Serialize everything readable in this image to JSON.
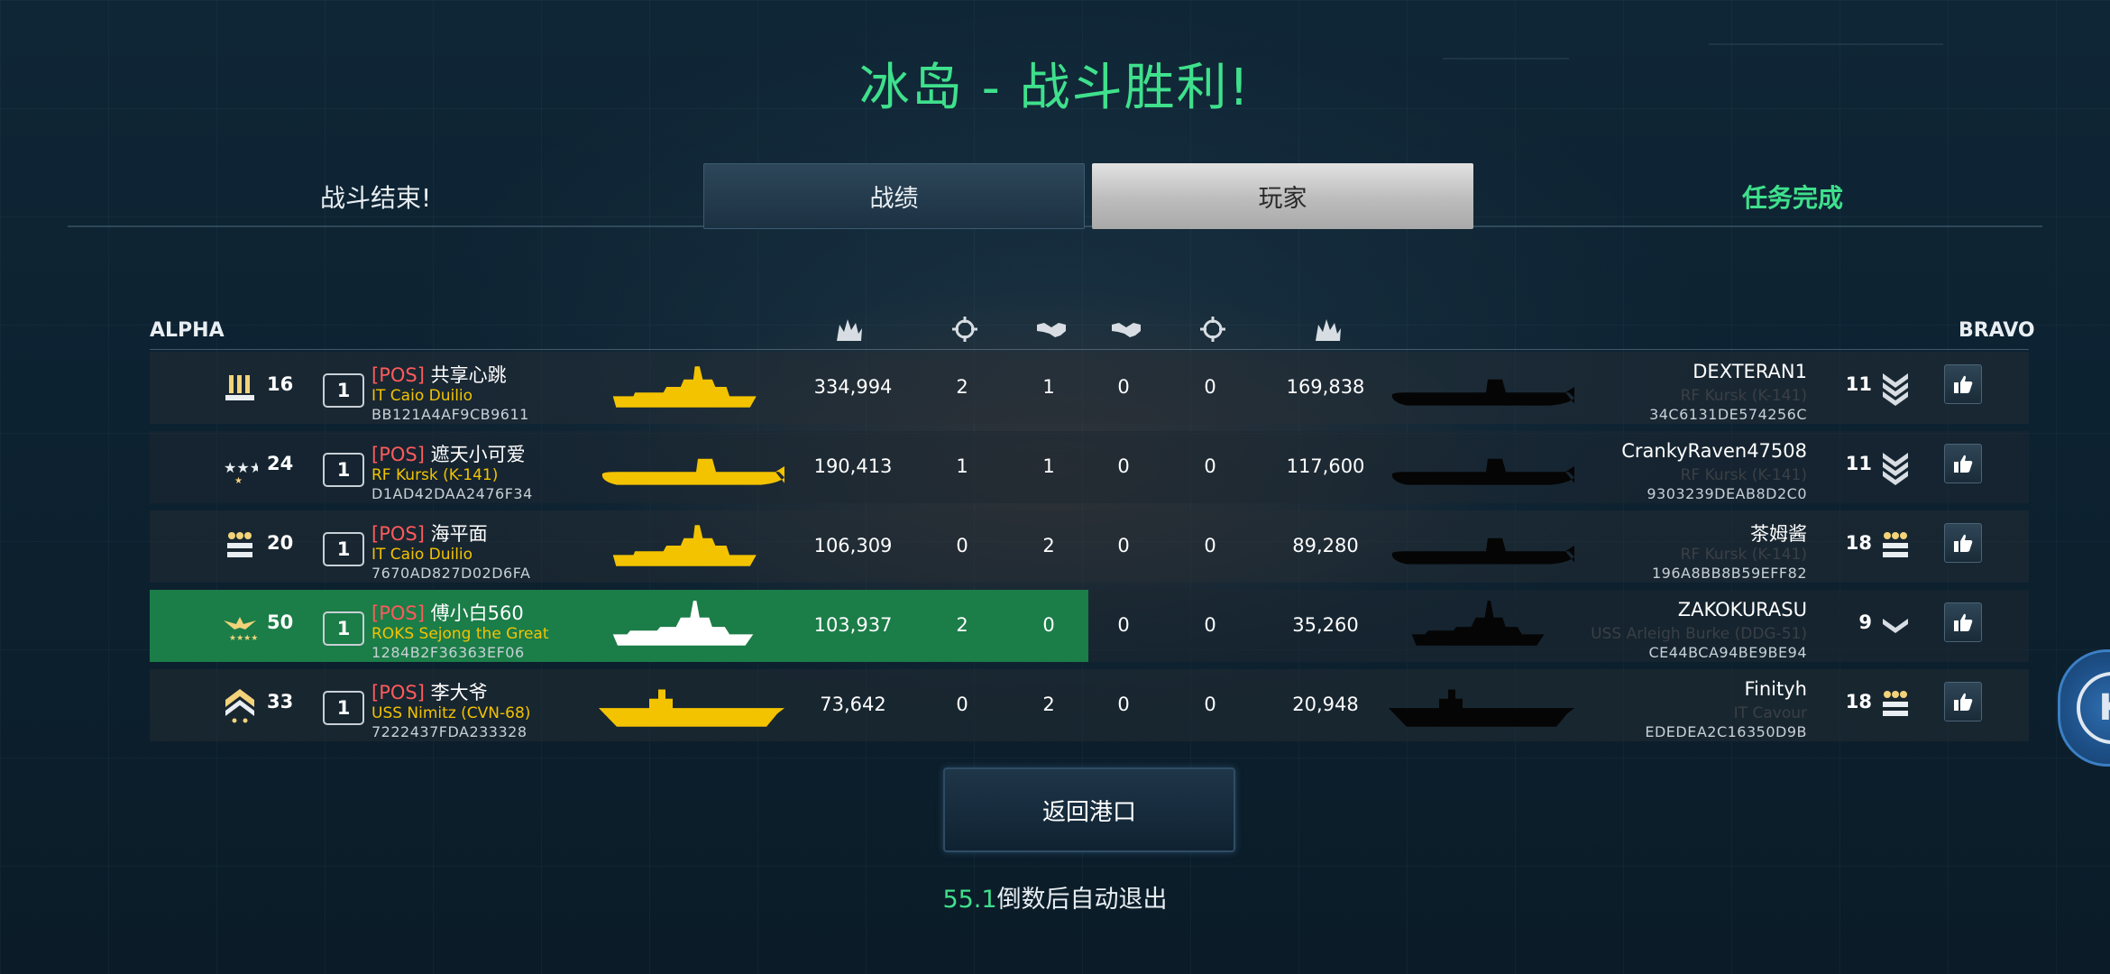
{
  "title": "冰岛 - 战斗胜利!",
  "header": {
    "battle_over": "战斗结束!",
    "tab_stats": "战绩",
    "tab_players": "玩家",
    "mission_status": "任务完成"
  },
  "teams": {
    "left": "ALPHA",
    "right": "BRAVO"
  },
  "column_icons": [
    "damage-icon",
    "crosshair-icon",
    "handshake-icon",
    "handshake-icon",
    "crosshair-icon",
    "damage-icon"
  ],
  "alpha": [
    {
      "level": "16",
      "position": "1",
      "tag": "[POS]",
      "name": "共享心跳",
      "ship": "IT Caio Duilio",
      "id": "BB121A4AF9CB9611",
      "score": "334,994",
      "kills": "2",
      "assists": "1",
      "rank_icon": "rank-bars-icon",
      "ship_class": "destroyer"
    },
    {
      "level": "24",
      "position": "1",
      "tag": "[POS]",
      "name": "遮天小可爱",
      "ship": "RF Kursk (K-141)",
      "id": "D1AD42DAA2476F34",
      "score": "190,413",
      "kills": "1",
      "assists": "1",
      "rank_icon": "rank-stars-icon",
      "ship_class": "submarine"
    },
    {
      "level": "20",
      "position": "1",
      "tag": "[POS]",
      "name": "海平面",
      "ship": "IT Caio Duilio",
      "id": "7670AD827D02D6FA",
      "score": "106,309",
      "kills": "0",
      "assists": "2",
      "rank_icon": "rank-stars-bar-icon",
      "ship_class": "destroyer"
    },
    {
      "level": "50",
      "position": "1",
      "tag": "[POS]",
      "name": "傅小白560",
      "ship": "ROKS Sejong the Great",
      "id": "1284B2F36363EF06",
      "score": "103,937",
      "kills": "2",
      "assists": "0",
      "rank_icon": "rank-eagle-icon",
      "ship_class": "cruiser"
    },
    {
      "level": "33",
      "position": "1",
      "tag": "[POS]",
      "name": "李大爷",
      "ship": "USS Nimitz (CVN-68)",
      "id": "7222437FDA233328",
      "score": "73,642",
      "kills": "0",
      "assists": "2",
      "rank_icon": "rank-chevron-icon",
      "ship_class": "carrier"
    }
  ],
  "bravo": [
    {
      "assists": "0",
      "kills": "0",
      "score": "169,838",
      "name": "DEXTERAN1",
      "ship": "RF Kursk (K-141)",
      "id": "34C6131DE574256C",
      "level": "11",
      "rank_icon": "rank-chevrons-icon",
      "ship_class": "submarine"
    },
    {
      "assists": "0",
      "kills": "0",
      "score": "117,600",
      "name": "CrankyRaven47508",
      "ship": "RF Kursk (K-141)",
      "id": "9303239DEAB8D2C0",
      "level": "11",
      "rank_icon": "rank-chevrons-icon",
      "ship_class": "submarine"
    },
    {
      "assists": "0",
      "kills": "0",
      "score": "89,280",
      "name": "茶姆酱",
      "ship": "RF Kursk (K-141)",
      "id": "196A8BB8B59EFF82",
      "level": "18",
      "rank_icon": "rank-stars-bar-icon",
      "ship_class": "submarine"
    },
    {
      "assists": "0",
      "kills": "0",
      "score": "35,260",
      "name": "ZAKOKURASU",
      "ship": "USS Arleigh Burke (DDG-51)",
      "id": "CE44BCA94BE9BE94",
      "level": "9",
      "rank_icon": "rank-chevron-small-icon",
      "ship_class": "cruiser"
    },
    {
      "assists": "0",
      "kills": "0",
      "score": "20,948",
      "name": "Finityh",
      "ship": "IT Cavour",
      "id": "EDEDEA2C16350D9B",
      "level": "18",
      "rank_icon": "rank-stars-bar-icon",
      "ship_class": "carrier"
    }
  ],
  "return_button": "返回港口",
  "countdown": {
    "seconds": "55.1",
    "text": "倒数后自动退出"
  },
  "side_button_letter": "K",
  "colors": {
    "accent_green": "#3fe08c",
    "ship_yellow": "#f4c300",
    "tag_red": "#ff5a5a",
    "highlight_row": "#1b7d48"
  }
}
